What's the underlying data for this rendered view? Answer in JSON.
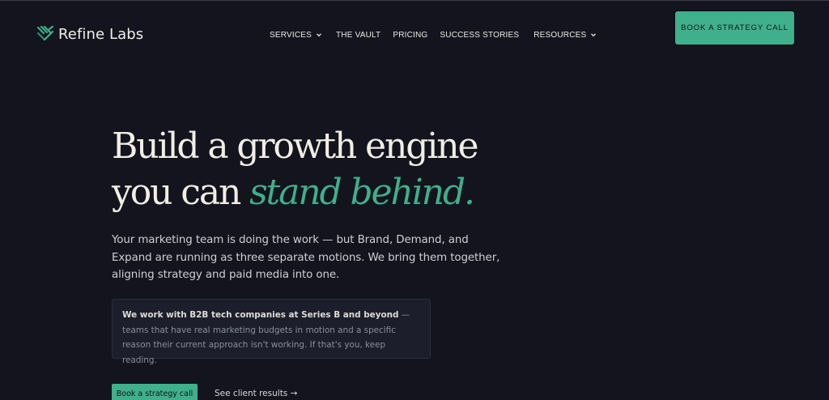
{
  "brand": {
    "name": "Refine Labs",
    "logo_icon": "striped-chevron-icon",
    "accent_color": "#3fb08b",
    "background_color": "#13141e"
  },
  "nav": {
    "items": [
      {
        "label": "SERVICES",
        "has_dropdown": true
      },
      {
        "label": "THE VAULT",
        "has_dropdown": false
      },
      {
        "label": "PRICING",
        "has_dropdown": false
      },
      {
        "label": "SUCCESS STORIES",
        "has_dropdown": false
      },
      {
        "label": "RESOURCES",
        "has_dropdown": true
      }
    ],
    "cta_label": "BOOK A STRATEGY CALL"
  },
  "hero": {
    "headline_line1": "Build a growth engine",
    "headline_line2_plain": "you can ",
    "headline_line2_accent": "stand behind.",
    "subtext": "Your marketing team is doing the work — but Brand, Demand, and Expand are running as three separate motions. We bring them together, aligning strategy and paid media into one.",
    "callout_strong": "We work with B2B tech companies at Series B and beyond",
    "callout_rest": " — teams that have real marketing budgets in motion and a specific reason their current approach isn't working. If that's you, keep reading.",
    "primary_button": "Book a strategy call",
    "secondary_link": "See client results →"
  }
}
